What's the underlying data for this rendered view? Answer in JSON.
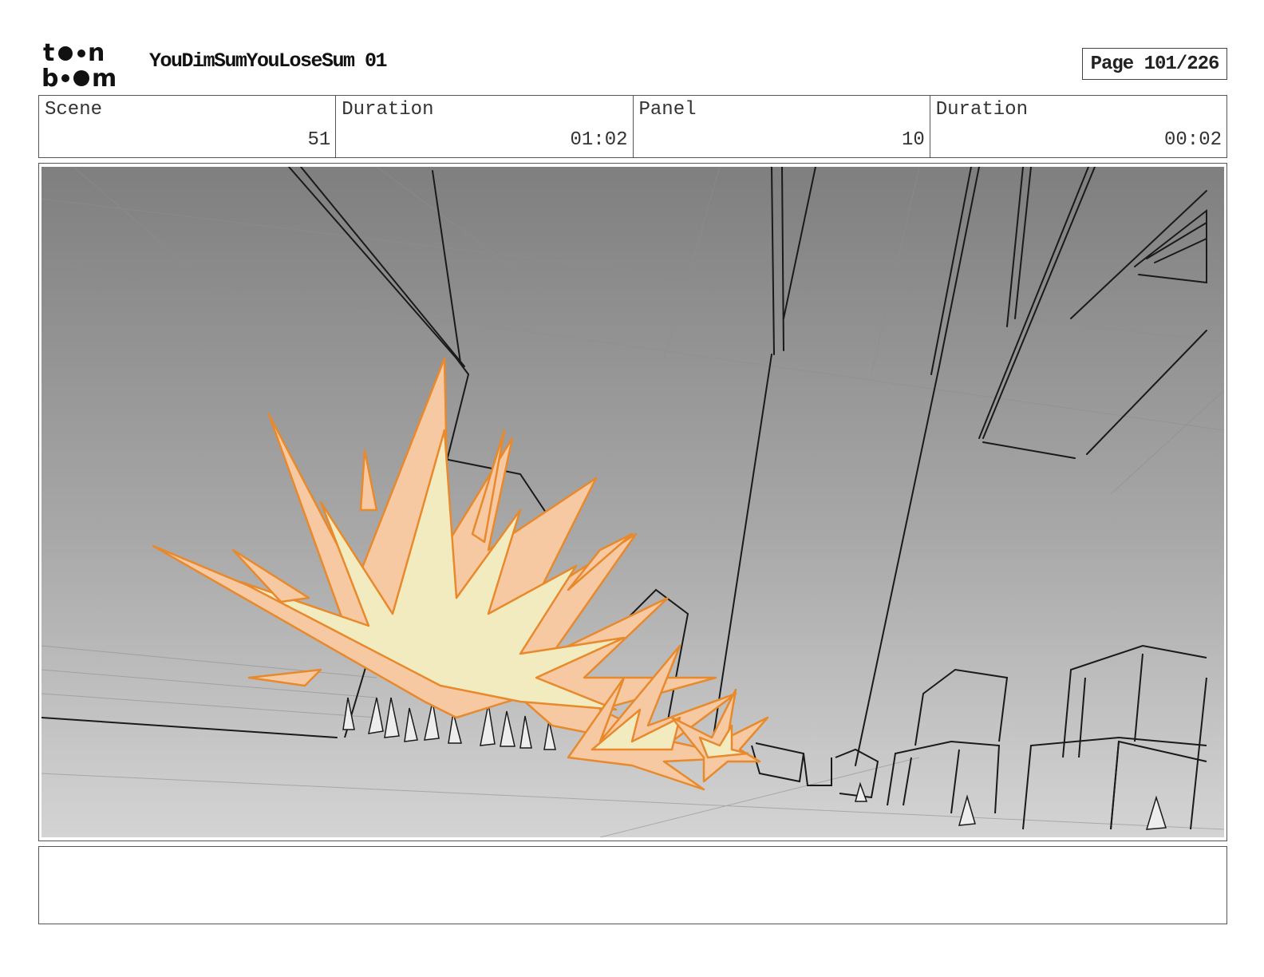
{
  "header": {
    "logo_text": "toonboom",
    "title": "YouDimSumYouLoseSum 01",
    "page": "Page 101/226"
  },
  "info": {
    "scene_label": "Scene",
    "scene_value": "51",
    "duration_label": "Duration",
    "duration_value": "01:02",
    "panel_label": "Panel",
    "panel_value": "10",
    "panel_duration_label": "Duration",
    "panel_duration_value": "00:02"
  },
  "panel": {
    "description": "",
    "colors": {
      "sky_top": "#7d7d7d",
      "sky_bottom": "#d2d2d2",
      "explosion_outline": "#e8892b",
      "explosion_fill": "#f6c9a3",
      "explosion_core": "#f3ebc0",
      "line": "#1a1a1a"
    }
  },
  "notes": {
    "text": ""
  }
}
